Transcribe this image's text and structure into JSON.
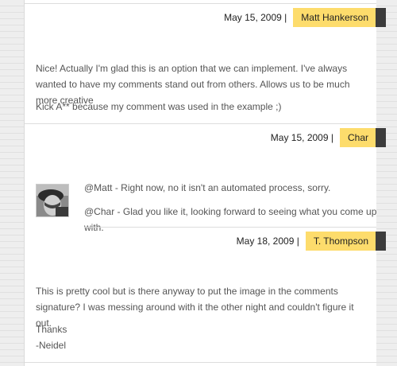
{
  "comments": [
    {
      "date": "May 15, 2009",
      "separator": "|",
      "author": "Matt Hankerson"
    },
    {
      "date": "May 15, 2009",
      "separator": "|",
      "author": "Char",
      "paragraphs": [
        "Nice! Actually I'm glad this is an option that we can implement. I've always wanted to have my comments stand out from others. Allows us to be much more creative",
        "Kick A** because my comment was used in the example ;)"
      ]
    },
    {
      "date": "May 18, 2009",
      "separator": "|",
      "author": "T. Thompson",
      "avatar_icon": "user-photo-avatar",
      "paragraphs": [
        "@Matt - Right now, no it isn't an automated process, sorry.",
        "@Char - Glad you like it, looking forward to seeing what you come up with."
      ]
    },
    {
      "paragraphs": [
        "This is pretty cool but is there anyway to put the image in the comments signature? I was messing around with it the other night and couldn't figure it out.",
        "Thanks",
        "-Neidel"
      ]
    }
  ],
  "colors": {
    "name_badge": "#fddc6c",
    "tab": "#3c3c3c",
    "text": "#555555"
  }
}
